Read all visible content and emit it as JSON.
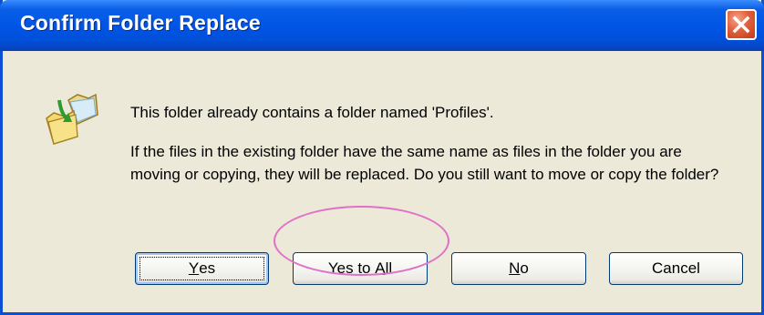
{
  "window": {
    "title": "Confirm Folder Replace",
    "close_icon": "close-icon"
  },
  "message": {
    "line1": "This folder already contains a folder named 'Profiles'.",
    "line2": "If the files in the existing folder have the same name as files in the folder you are moving or copying, they will be replaced.  Do you still want to move or copy the folder?"
  },
  "icons": {
    "dialog_icon": "folder-replace-icon"
  },
  "buttons": {
    "yes": {
      "mnemonic": "Y",
      "rest": "es"
    },
    "yes_to_all": {
      "before": "Yes to ",
      "mnemonic": "A",
      "rest": "ll"
    },
    "no": {
      "mnemonic": "N",
      "rest": "o"
    },
    "cancel": "Cancel"
  },
  "colors": {
    "titlebar": "#0055e5",
    "dialog_bg": "#ece9d8",
    "close_button": "#e0603e",
    "annotation": "#e070c8"
  }
}
